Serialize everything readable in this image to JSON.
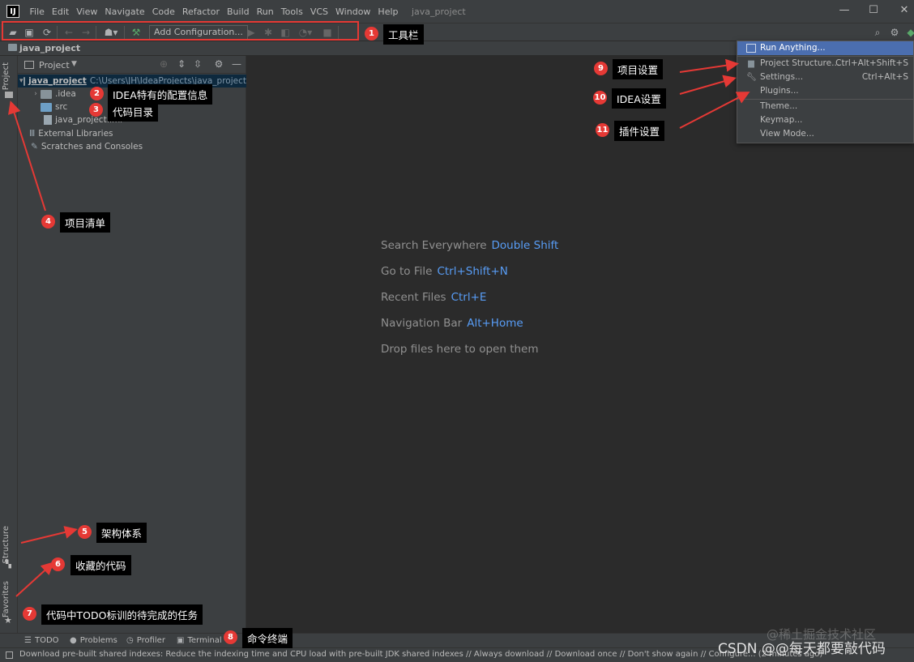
{
  "window": {
    "logo": "IJ",
    "title": "java_project",
    "menu": [
      "File",
      "Edit",
      "View",
      "Navigate",
      "Code",
      "Refactor",
      "Build",
      "Run",
      "Tools",
      "VCS",
      "Window",
      "Help"
    ],
    "minimize": "—",
    "maximize": "☐",
    "close": "✕"
  },
  "toolbar": {
    "add_configuration": "Add Configuration...",
    "icons": [
      "open-folder-icon",
      "save-icon",
      "sync-icon",
      "back-icon",
      "forward-icon",
      "user-icon",
      "build-icon",
      "run-icon",
      "debug-icon",
      "coverage-icon",
      "profile-icon",
      "stop-icon",
      "search-icon",
      "gear-icon"
    ]
  },
  "navbar": {
    "breadcrumb": "java_project"
  },
  "left_strip": {
    "project_tab": "Project",
    "structure_tab": "Structure",
    "favorites_tab": "Favorites"
  },
  "project_panel": {
    "title": "Project",
    "tree": {
      "root_name": "java_project",
      "root_path": "C:\\Users\\JH\\IdeaProjects\\java_project",
      "idea": ".idea",
      "src": "src",
      "iml": "java_project.iml",
      "external": "External Libraries",
      "scratches": "Scratches and Consoles"
    }
  },
  "editor_hints": [
    {
      "text": "Search Everywhere",
      "key": "Double Shift"
    },
    {
      "text": "Go to File",
      "key": "Ctrl+Shift+N"
    },
    {
      "text": "Recent Files",
      "key": "Ctrl+E"
    },
    {
      "text": "Navigation Bar",
      "key": "Alt+Home"
    },
    {
      "text": "Drop files here to open them",
      "key": ""
    }
  ],
  "settings_menu": {
    "run_anything": "Run Anything...",
    "project_structure": "Project Structure...",
    "project_structure_shortcut": "Ctrl+Alt+Shift+S",
    "settings": "Settings...",
    "settings_shortcut": "Ctrl+Alt+S",
    "plugins": "Plugins...",
    "theme": "Theme...",
    "keymap": "Keymap...",
    "view_mode": "View Mode..."
  },
  "bottom_tools": {
    "todo": "TODO",
    "problems": "Problems",
    "profiler": "Profiler",
    "terminal": "Terminal"
  },
  "status_bar": {
    "text": "Download pre-built shared indexes: Reduce the indexing time and CPU load with pre-built JDK shared indexes // Always download // Download once // Don't show again // Configure... (2 minutes ago)"
  },
  "annotations": {
    "a1": {
      "num": "1",
      "label": "工具栏"
    },
    "a2": {
      "num": "2",
      "label": "IDEA特有的配置信息"
    },
    "a3": {
      "num": "3",
      "label": "代码目录"
    },
    "a4": {
      "num": "4",
      "label": "项目清单"
    },
    "a5": {
      "num": "5",
      "label": "架构体系"
    },
    "a6": {
      "num": "6",
      "label": "收藏的代码"
    },
    "a7": {
      "num": "7",
      "label": "代码中TODO标训的待完成的任务"
    },
    "a8": {
      "num": "8",
      "label": "命令终端"
    },
    "a9": {
      "num": "9",
      "label": "项目设置"
    },
    "a10": {
      "num": "10",
      "label": "IDEA设置"
    },
    "a11": {
      "num": "11",
      "label": "插件设置"
    }
  },
  "watermark": {
    "main": "CSDN @@每天都要敲代码",
    "faint": "@稀土掘金技术社区"
  },
  "colors": {
    "accent_red": "#e53935",
    "menu_highlight": "#4b6eaf",
    "key_blue": "#589df6"
  }
}
